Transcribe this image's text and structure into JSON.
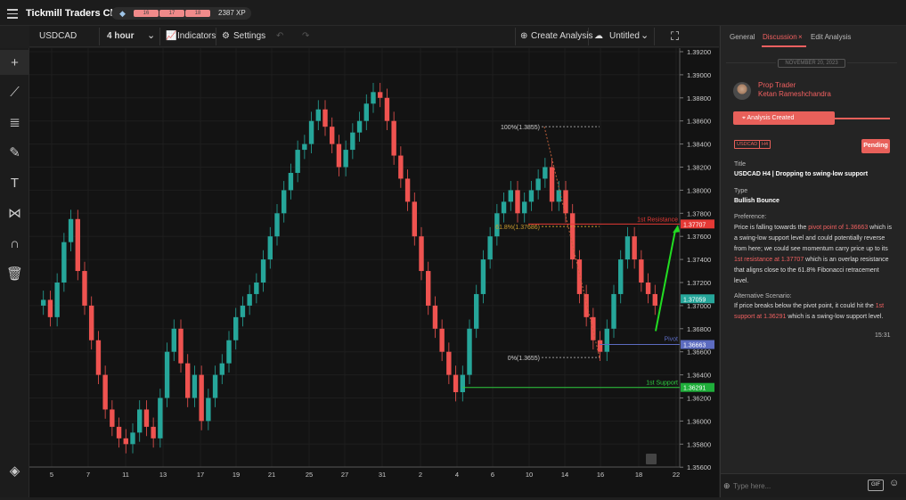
{
  "app": {
    "title": "Tickmill Traders Club",
    "levels": [
      "16",
      "17",
      "18"
    ],
    "xp": "2387 XP"
  },
  "toolbar": {
    "symbol": "USDCAD",
    "timeframe": "4 hour",
    "indicators": "Indicators",
    "settings": "Settings",
    "create_analysis": "Create Analysis",
    "untitled": "Untitled"
  },
  "chart": {
    "price_axis": [
      "1.39200",
      "1.39000",
      "1.38800",
      "1.38600",
      "1.38400",
      "1.38200",
      "1.38000",
      "1.37800",
      "1.37600",
      "1.37400",
      "1.37200",
      "1.37000",
      "1.36800",
      "1.36600",
      "1.36400",
      "1.36200",
      "1.36000",
      "1.35800",
      "1.35600"
    ],
    "date_axis": [
      "5",
      "7",
      "11",
      "13",
      "17",
      "19",
      "21",
      "25",
      "27",
      "31",
      "2",
      "4",
      "6",
      "10",
      "14",
      "16",
      "18",
      "22"
    ],
    "annotations": {
      "fib100": "100%(1.3855)",
      "fib618": "61.8%(1.37686)",
      "fib0": "0%(1.3655)",
      "resistance": "1st Resistance",
      "pivot": "Pivot",
      "support": "1st Support"
    },
    "price_tags": {
      "resistance": "1.37707",
      "current": "1.37059",
      "pivot": "1.36663",
      "support": "1.36291"
    },
    "colors": {
      "up": "#26a69a",
      "down": "#ef5350",
      "resistance": "#e53935",
      "support": "#2ecc40",
      "pivot": "#5c6bc0",
      "arrow": "#22dd22"
    }
  },
  "panel": {
    "tabs": [
      "General",
      "Discussion",
      "Edit Analysis"
    ],
    "date": "NOVEMBER 20, 2023",
    "user_role": "Prop Trader",
    "user_name": "Ketan Rameshchandra",
    "banner": "Analysis Created",
    "tags": [
      "USDCAD",
      "H4"
    ],
    "status": "Pending",
    "title_label": "Title",
    "title_value": "USDCAD H4 | Dropping to swing-low support",
    "type_label": "Type",
    "type_value": "Bullish Bounce",
    "pref_label": "Preference:",
    "pref_a": "Price is falling towards the ",
    "pref_b": "pivot point of 1.36663",
    "pref_c": " which is a swing-low support level and could potentially reverse from here; we could see momentum carry price up to its ",
    "pref_d": "1st resistance at 1.37707",
    "pref_e": " which is an overlap resistance that aligns close to the 61.8% Fibonacci retracement level.",
    "alt_label": "Alternative Scenario:",
    "alt_a": "If price breaks below the pivot point, it could hit the ",
    "alt_b": "1st support at 1.36291",
    "alt_c": " which is a swing-low support level.",
    "time": "15:31",
    "input_placeholder": "Type here...",
    "gif": "GIF"
  }
}
